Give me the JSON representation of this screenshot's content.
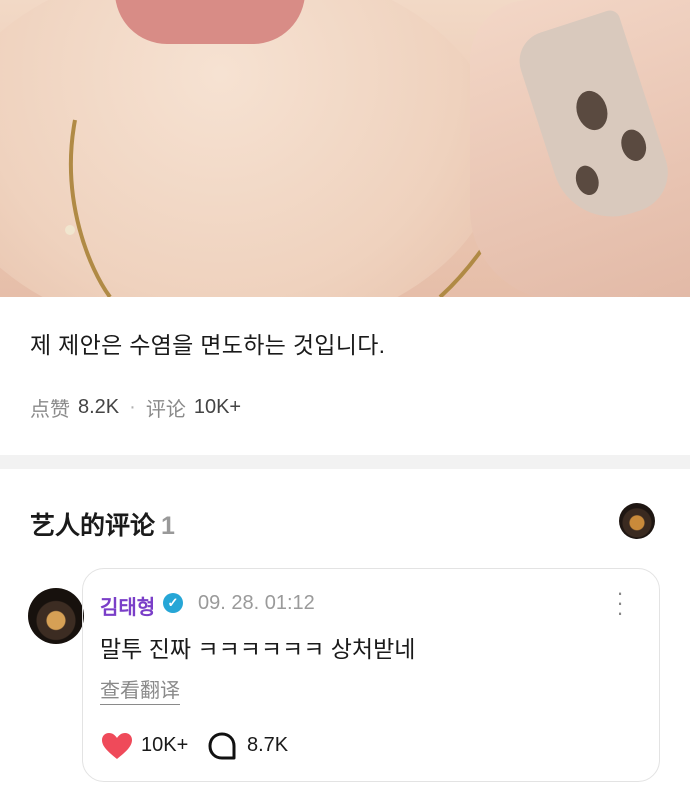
{
  "post": {
    "text": "제 제안은 수염을 면도하는 것입니다.",
    "like_label": "点赞",
    "like_count": "8.2K",
    "separator": "·",
    "comment_label": "评论",
    "comment_count": "10K+"
  },
  "artist_comments": {
    "title": "艺人的评论",
    "count": "1",
    "comment": {
      "author": "김태형",
      "verified_icon": "verified-check-icon",
      "timestamp": "09. 28. 01:12",
      "text": "말투 진짜 ㅋㅋㅋㅋㅋㅋ 상처받네",
      "translate_label": "查看翻译",
      "like_count": "10K+",
      "reply_count": "8.7K",
      "like_color": "#ef4a5a"
    }
  }
}
